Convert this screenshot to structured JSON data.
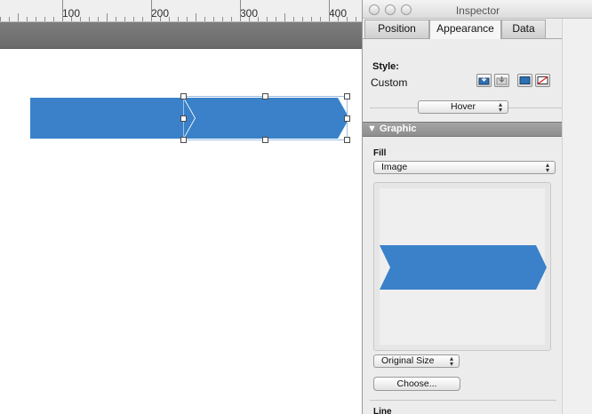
{
  "ruler": {
    "labels": [
      "100",
      "200",
      "300",
      "400"
    ]
  },
  "inspector": {
    "title": "Inspector",
    "tabs": [
      {
        "label": "Position"
      },
      {
        "label": "Appearance"
      },
      {
        "label": "Data"
      }
    ],
    "style_label": "Style:",
    "style_value": "Custom",
    "state_select": "Hover",
    "section_title": "Graphic",
    "section_toggle": "▼",
    "fill_label": "Fill",
    "fill_type": "Image",
    "size_mode": "Original Size",
    "choose_button": "Choose...",
    "line_label": "Line"
  },
  "colors": {
    "shape_fill": "#3a81c9",
    "selection_handle": "#4a4a4a"
  }
}
